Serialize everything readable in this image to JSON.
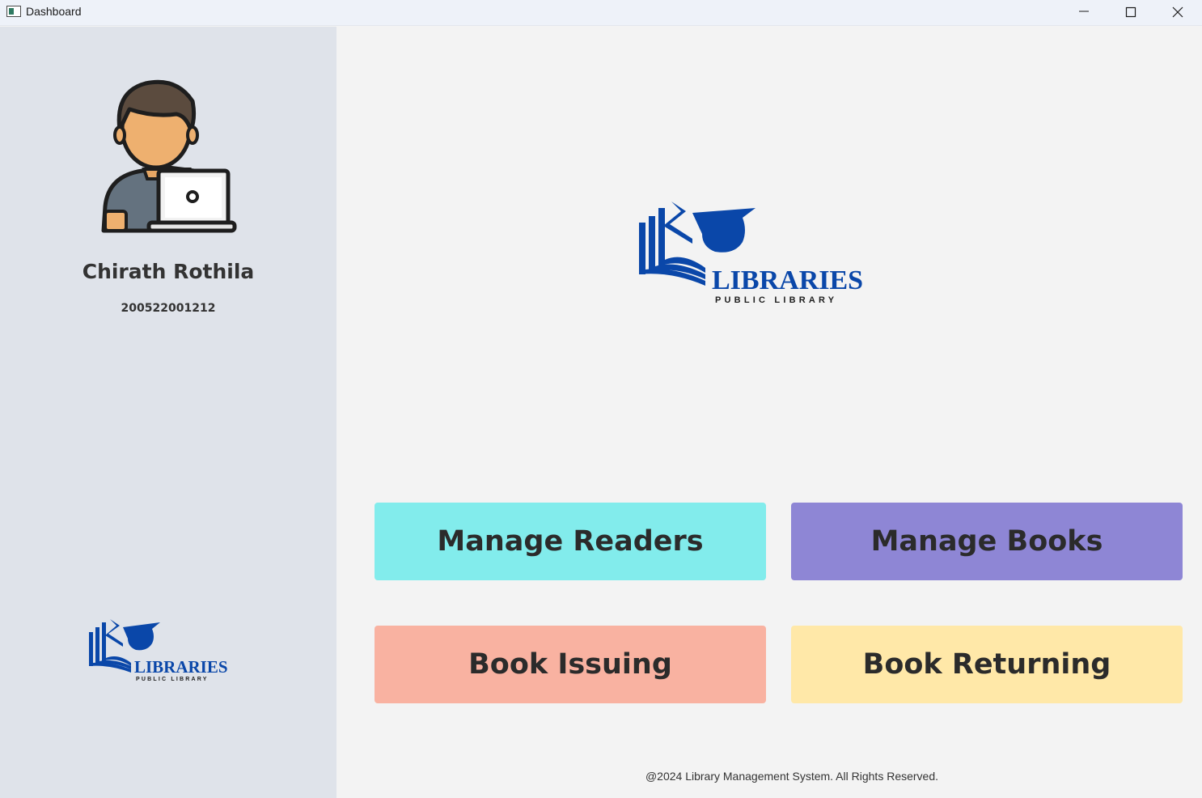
{
  "window": {
    "title": "Dashboard"
  },
  "colors": {
    "logo_blue": "#0a47a9",
    "sidebar_bg": "#dfe3ea",
    "main_bg": "#f3f3f3",
    "tile_readers": "#82ecec",
    "tile_books": "#8e86d5",
    "tile_issuing": "#f9b2a1",
    "tile_returning": "#ffe8a8"
  },
  "sidebar": {
    "user_name": "Chirath Rothila",
    "user_id": "200522001212",
    "avatar_icon": "user-with-laptop-icon",
    "logo": {
      "word": "LIBRARIES",
      "sub": "PUBLIC LIBRARY"
    }
  },
  "main": {
    "logo": {
      "word": "LIBRARIES",
      "sub": "PUBLIC LIBRARY"
    },
    "tiles": [
      {
        "label": "Manage Readers"
      },
      {
        "label": "Manage Books"
      },
      {
        "label": "Book Issuing"
      },
      {
        "label": "Book Returning"
      }
    ],
    "footer": "@2024 Library Management System. All Rights Reserved."
  }
}
